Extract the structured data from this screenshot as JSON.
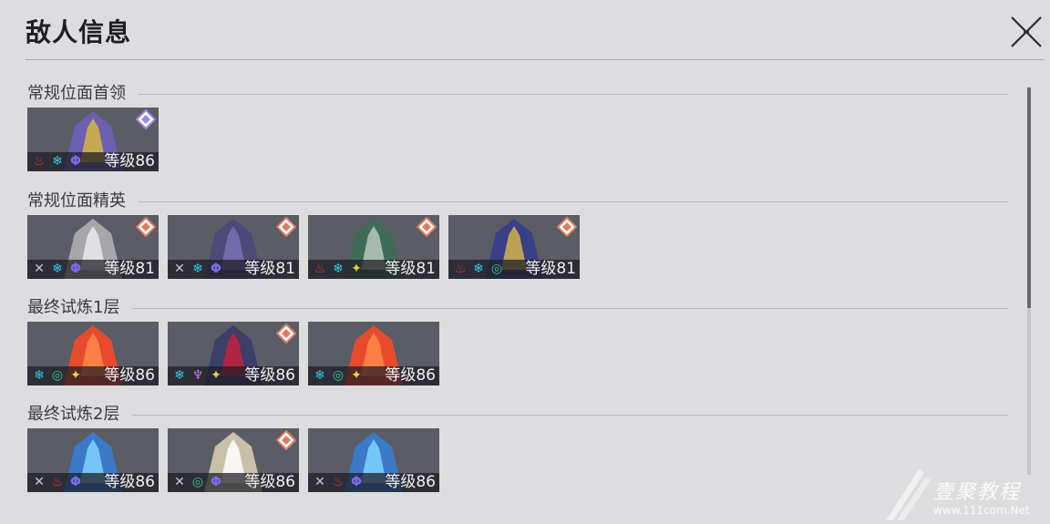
{
  "header": {
    "title": "敌人信息",
    "close_icon": "close-icon"
  },
  "colors": {
    "background": "#dddddf",
    "elite_badge": "#e07a5f",
    "boss_badge": "#9a86e8",
    "fire": "#e23a3a",
    "ice": "#35c8e6",
    "quantum": "#7b6cf0",
    "physical": "#c8c8c8",
    "wind": "#3fc48a",
    "lightning": "#c774f0",
    "imaginary": "#f2cf3a"
  },
  "sections": [
    {
      "title": "常规位面首领",
      "enemies": [
        {
          "name": "boss",
          "badge": "boss",
          "weaknesses": [
            "fire",
            "ice",
            "quantum"
          ],
          "level": "等级86"
        }
      ]
    },
    {
      "title": "常规位面精英",
      "enemies": [
        {
          "name": "elite-1",
          "badge": "elite",
          "weaknesses": [
            "physical",
            "ice",
            "quantum"
          ],
          "level": "等级81"
        },
        {
          "name": "elite-2",
          "badge": "elite",
          "weaknesses": [
            "physical",
            "ice",
            "quantum"
          ],
          "level": "等级81"
        },
        {
          "name": "elite-3",
          "badge": "elite",
          "weaknesses": [
            "fire",
            "ice",
            "imaginary"
          ],
          "level": "等级81"
        },
        {
          "name": "elite-4",
          "badge": "elite",
          "weaknesses": [
            "fire",
            "ice",
            "wind"
          ],
          "level": "等级81"
        }
      ]
    },
    {
      "title": "最终试炼1层",
      "enemies": [
        {
          "name": "trial1-1",
          "badge": "",
          "weaknesses": [
            "ice",
            "wind",
            "imaginary"
          ],
          "level": "等级86"
        },
        {
          "name": "trial1-2",
          "badge": "elite",
          "weaknesses": [
            "ice",
            "lightning",
            "imaginary"
          ],
          "level": "等级86"
        },
        {
          "name": "trial1-3",
          "badge": "",
          "weaknesses": [
            "ice",
            "wind",
            "imaginary"
          ],
          "level": "等级86"
        }
      ]
    },
    {
      "title": "最终试炼2层",
      "enemies": [
        {
          "name": "trial2-1",
          "badge": "",
          "weaknesses": [
            "physical",
            "fire",
            "quantum"
          ],
          "level": "等级86"
        },
        {
          "name": "trial2-2",
          "badge": "elite",
          "weaknesses": [
            "physical",
            "wind",
            "quantum"
          ],
          "level": "等级86"
        },
        {
          "name": "trial2-3",
          "badge": "",
          "weaknesses": [
            "physical",
            "fire",
            "quantum"
          ],
          "level": "等级86"
        }
      ]
    }
  ],
  "watermark": {
    "text": "壹聚教程",
    "url": "www.111com.Net"
  }
}
